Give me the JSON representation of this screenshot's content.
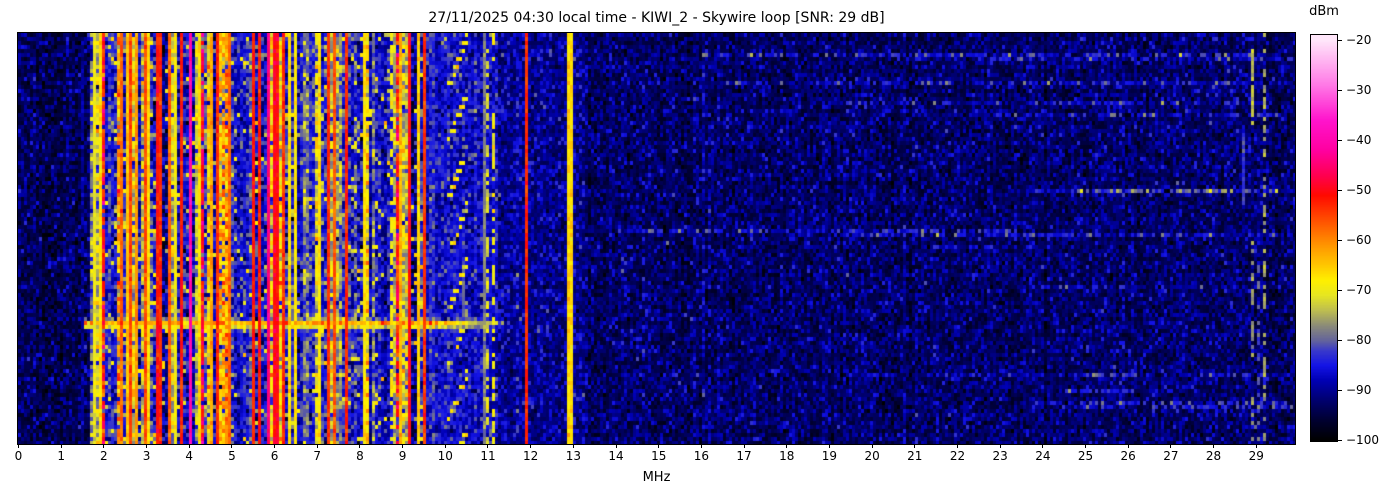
{
  "title": "27/11/2025 04:30 local time - KIWI_2 - Skywire loop [SNR: 29 dB]",
  "x_axis": {
    "label": "MHz",
    "ticks": [
      0,
      1,
      2,
      3,
      4,
      5,
      6,
      7,
      8,
      9,
      10,
      11,
      12,
      13,
      14,
      15,
      16,
      17,
      18,
      19,
      20,
      21,
      22,
      23,
      24,
      25,
      26,
      27,
      28,
      29
    ]
  },
  "colorbar": {
    "label": "dBm",
    "tick_labels": [
      "−20",
      "−30",
      "−40",
      "−50",
      "−60",
      "−70",
      "−80",
      "−90",
      "−100"
    ]
  },
  "chart_data": {
    "type": "heatmap",
    "title": "27/11/2025 04:30 local time - KIWI_2 - Skywire loop [SNR: 29 dB]",
    "xlabel": "MHz",
    "x_range_mhz": [
      0,
      29.92
    ],
    "x_ticks": [
      0,
      1,
      2,
      3,
      4,
      5,
      6,
      7,
      8,
      9,
      10,
      11,
      12,
      13,
      14,
      15,
      16,
      17,
      18,
      19,
      20,
      21,
      22,
      23,
      24,
      25,
      26,
      27,
      28,
      29
    ],
    "value_axis": {
      "label": "dBm",
      "min": -100,
      "max": -20,
      "tick_step": 10
    },
    "snr_db": 29,
    "legend_position": "right-colorbar",
    "grid": false,
    "seed": 20251127,
    "colormap_stops": [
      [
        -100,
        "#000000"
      ],
      [
        -96,
        "#000030"
      ],
      [
        -92,
        "#00006E"
      ],
      [
        -88,
        "#0000B4"
      ],
      [
        -85,
        "#1414E6"
      ],
      [
        -82,
        "#3A3ACA"
      ],
      [
        -80,
        "#64649B"
      ],
      [
        -77,
        "#8C8C78"
      ],
      [
        -74,
        "#BEBE50"
      ],
      [
        -71,
        "#E6E622"
      ],
      [
        -68,
        "#FFF000"
      ],
      [
        -65,
        "#FFC800"
      ],
      [
        -61,
        "#FF9600"
      ],
      [
        -56,
        "#FF5000"
      ],
      [
        -51,
        "#FF0A00"
      ],
      [
        -47,
        "#FF0050"
      ],
      [
        -42,
        "#FF00A0"
      ],
      [
        -36,
        "#FF14CC"
      ],
      [
        -29,
        "#FF78E6"
      ],
      [
        -20,
        "#FFE6FA"
      ]
    ],
    "noise_bands": [
      {
        "f0": 0.0,
        "f1": 1.7,
        "base": -95.5,
        "sig": 2.0,
        "mode": "noise"
      },
      {
        "f0": 1.7,
        "f1": 9.55,
        "mode": "active"
      },
      {
        "f0": 9.55,
        "f1": 11.22,
        "base": -86.5,
        "sig": 3.2,
        "mode": "med"
      },
      {
        "f0": 11.22,
        "f1": 13.25,
        "base": -92.0,
        "sig": 2.2,
        "mode": "noise"
      },
      {
        "f0": 13.25,
        "f1": 29.92,
        "base": -94.5,
        "sig": 2.0,
        "mode": "noise"
      }
    ],
    "active_mix": {
      "blue": [
        -86,
        0.38
      ],
      "yellow": [
        -71,
        0.33
      ],
      "orange": [
        -63,
        0.12
      ],
      "red": [
        -53,
        0.11
      ],
      "gray": [
        -78,
        0.06
      ]
    },
    "blue_gaps": [
      [
        2.02,
        2.3
      ],
      [
        5.08,
        5.42
      ],
      [
        6.58,
        6.97
      ],
      [
        8.25,
        8.62
      ]
    ],
    "carrier_lines": [
      {
        "f": 1.76,
        "dbm": -69
      },
      {
        "f": 1.88,
        "dbm": -67
      },
      {
        "f": 2.38,
        "dbm": -58
      },
      {
        "f": 2.5,
        "dbm": -65
      },
      {
        "f": 2.62,
        "dbm": -56
      },
      {
        "f": 2.72,
        "dbm": -61
      },
      {
        "f": 2.95,
        "dbm": -55,
        "w": 2
      },
      {
        "f": 3.05,
        "dbm": -68
      },
      {
        "f": 3.2,
        "dbm": -52
      },
      {
        "f": 3.33,
        "dbm": -54
      },
      {
        "f": 3.48,
        "dbm": -56
      },
      {
        "f": 3.62,
        "dbm": -68
      },
      {
        "f": 3.78,
        "dbm": -52
      },
      {
        "f": 4.0,
        "dbm": -40
      },
      {
        "f": 4.22,
        "dbm": -66
      },
      {
        "f": 4.47,
        "dbm": -62
      },
      {
        "f": 4.65,
        "dbm": -54
      },
      {
        "f": 4.9,
        "dbm": -57
      },
      {
        "f": 5.5,
        "dbm": -52
      },
      {
        "f": 5.65,
        "dbm": -53
      },
      {
        "f": 5.8,
        "dbm": -44
      },
      {
        "f": 5.95,
        "dbm": -50,
        "w": 2
      },
      {
        "f": 6.07,
        "dbm": -52
      },
      {
        "f": 6.2,
        "dbm": -55
      },
      {
        "f": 6.35,
        "dbm": -66
      },
      {
        "f": 6.48,
        "dbm": -68
      },
      {
        "f": 7.05,
        "dbm": -67
      },
      {
        "f": 7.22,
        "dbm": -53
      },
      {
        "f": 7.35,
        "dbm": -55
      },
      {
        "f": 7.65,
        "dbm": -52
      },
      {
        "f": 8.08,
        "dbm": -66
      },
      {
        "f": 8.7,
        "dbm": -69,
        "dot": 0.6,
        "bg": -85
      },
      {
        "f": 8.95,
        "dbm": -63
      },
      {
        "f": 9.16,
        "dbm": -50
      },
      {
        "f": 9.32,
        "dbm": -67
      },
      {
        "f": 9.5,
        "dbm": -54
      },
      {
        "f": 10.9,
        "dbm": -79
      },
      {
        "f": 10.97,
        "dbm": -72,
        "dot": 0.55,
        "bg": -86
      },
      {
        "f": 11.12,
        "dbm": -70,
        "dot": 0.5,
        "bg": -87
      },
      {
        "f": 11.9,
        "dbm": -54
      },
      {
        "f": 12.85,
        "dbm": -67,
        "w": 2
      }
    ],
    "sporadic_lines": [
      {
        "f": 1.45,
        "dbm": -89.5,
        "rows": [
          0,
          103
        ],
        "p": 0.75
      },
      {
        "f": 14.65,
        "dbm": -84.0,
        "rows": [
          10,
          96
        ],
        "p": 0.25
      },
      {
        "f": 16.15,
        "dbm": -86.0,
        "rows": [
          20,
          100
        ],
        "p": 0.18
      },
      {
        "f": 28.7,
        "dbm": -82.0,
        "rows": [
          25,
          43
        ],
        "p": 0.95
      },
      {
        "f": 28.88,
        "dbm": -74.0,
        "rows": [
          4,
          23
        ],
        "p": 0.9
      },
      {
        "f": 28.88,
        "dbm": -77.0,
        "rows": [
          50,
          103
        ],
        "p": 0.45
      },
      {
        "f": 29.05,
        "dbm": -80.0,
        "rows": [
          55,
          103
        ],
        "p": 0.3
      },
      {
        "f": 29.2,
        "dbm": -76.0,
        "rows": [
          0,
          103
        ],
        "p": 0.5
      }
    ],
    "ionosonde": {
      "f0": 10.02,
      "f1": 10.45,
      "dbm": -68,
      "note": "diagonal dashed sweep trace"
    },
    "blue_segment": {
      "f": 10.42,
      "rows": [
        58,
        75
      ],
      "dbm": -81
    },
    "burst": {
      "y_frac": 0.695,
      "f0": 1.55,
      "f1": 11.3,
      "dbm": -64,
      "note": "wideband horizontal burst"
    },
    "h_streaks": {
      "count": 16,
      "f0": 13.4,
      "f1": 29.8,
      "boost_min": 4,
      "boost_max": 9
    },
    "bright_streaks": [
      {
        "row": 5,
        "f0": 16.0,
        "f1": 29.5,
        "boost": 8
      },
      {
        "row": 17,
        "f0": 19.0,
        "f1": 29.3,
        "boost": 6
      }
    ]
  }
}
